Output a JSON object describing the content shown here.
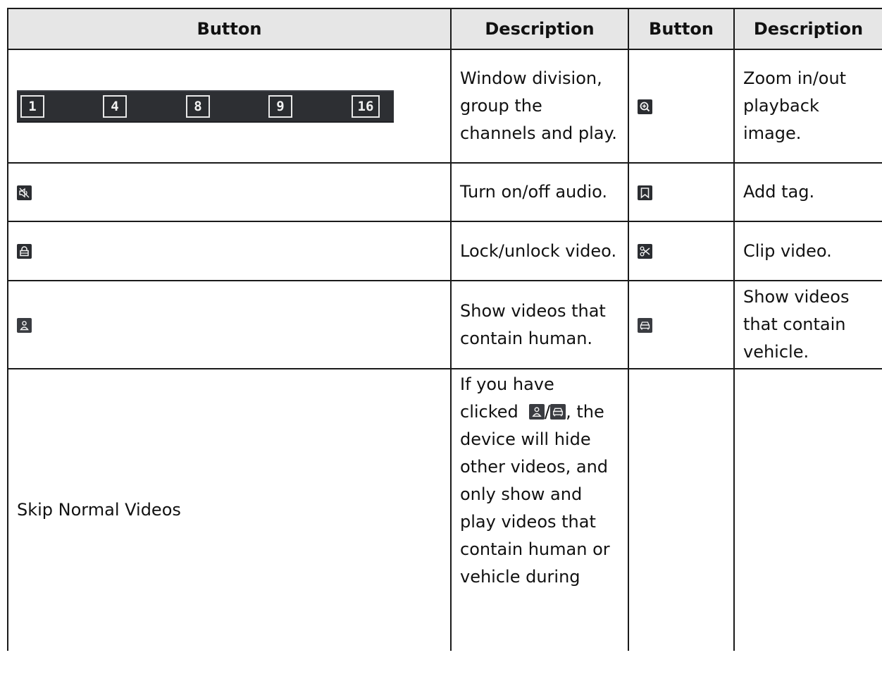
{
  "table": {
    "headers": [
      "Button",
      "Description",
      "Button",
      "Description"
    ],
    "rows": [
      {
        "left_button": {
          "type": "division-strip",
          "buttons": [
            "1",
            "4",
            "8",
            "9",
            "16"
          ]
        },
        "left_description": "Window division, group the channels and play.",
        "right_button_icon": "zoom-in-icon",
        "right_description": "Zoom in/out playback image."
      },
      {
        "left_button_icon": "audio-mute-icon",
        "left_description": "Turn on/off audio.",
        "right_button_icon": "tag-icon",
        "right_description": "Add tag."
      },
      {
        "left_button_icon": "lock-icon",
        "left_description": "Lock/unlock video.",
        "right_button_icon": "scissors-icon",
        "right_description": "Clip video."
      },
      {
        "left_button_icon": "human-icon",
        "left_description": "Show videos that contain human.",
        "right_button_icon": "vehicle-icon",
        "right_description": "Show videos that contain vehicle."
      },
      {
        "left_button_label": "Skip Normal Videos",
        "left_description": {
          "before": "If you have clicked",
          "separator": "/",
          "after": ", the device will hide other videos, and only show and play videos that contain human or vehicle during"
        },
        "right_button": "",
        "right_description": ""
      }
    ]
  },
  "colors": {
    "header_background": "#e6e6e6",
    "border": "#1a1a1a",
    "icon_background": "#2b2d31",
    "icon_foreground": "#f2f2f2"
  }
}
